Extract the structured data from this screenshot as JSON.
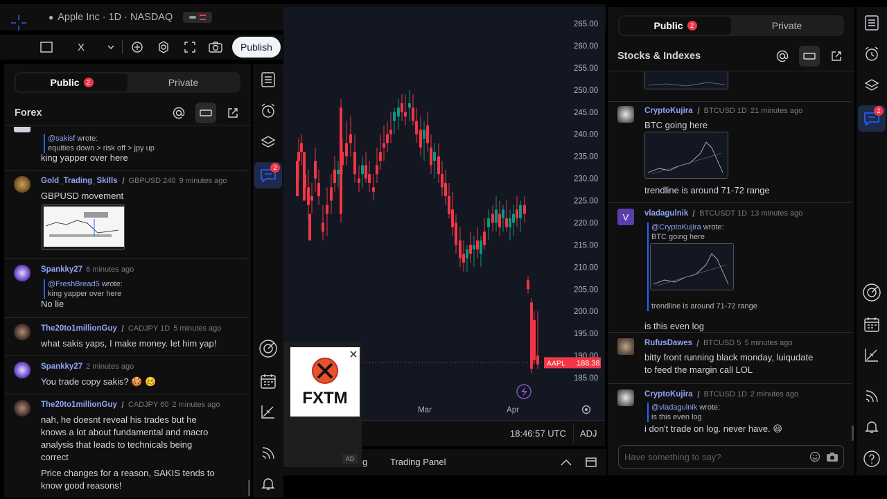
{
  "top": {
    "symbol_title": "Apple Inc · 1D · NASDAQ",
    "publish_label": "Publish",
    "toolbar_x_label": "X"
  },
  "left_chat": {
    "tab_public": "Public",
    "tab_private": "Private",
    "public_badge": "2",
    "room_title": "Forex",
    "messages": [
      {
        "quote_user": "@sakisf",
        "quote_wrote": "wrote:",
        "quote_text": "equities down > risk off > jpy up",
        "text": "king yapper over here"
      },
      {
        "user": "Gold_Trading_Skills",
        "symbol": "GBPUSD 240",
        "time": "9 minutes ago",
        "text": "GBPUSD movement"
      },
      {
        "user": "Spankky27",
        "time": "6 minutes ago",
        "quote_user": "@FreshBread5",
        "quote_wrote": "wrote:",
        "quote_text": "king yapper over here",
        "text": "No lie"
      },
      {
        "user": "The20to1millionGuy",
        "symbol": "CADJPY 1D",
        "time": "5 minutes ago",
        "text": "what sakis yaps, I make money. let him yap!"
      },
      {
        "user": "Spankky27",
        "time": "2 minutes ago",
        "text": "You trade copy sakis? 🍪 🥴"
      },
      {
        "user": "The20to1millionGuy",
        "symbol": "CADJPY 60",
        "time": "2 minutes ago",
        "text_lines": [
          "nah, he doesnt reveal his trades but he",
          "knows a lot about fundamental and macro",
          "analysis that leads to technicals being",
          "correct"
        ],
        "text2_lines": [
          "Price changes for a reason, SAKIS tends to",
          "know good reasons!"
        ]
      }
    ]
  },
  "mid_strip": {
    "chat_badge": "2"
  },
  "chart": {
    "price_labels": [
      "265.00",
      "260.00",
      "255.00",
      "250.00",
      "245.00",
      "240.00",
      "235.00",
      "230.00",
      "225.00",
      "220.00",
      "215.00",
      "210.00",
      "205.00",
      "200.00",
      "195.00",
      "190.00",
      "185.00"
    ],
    "time_labels": [
      "Mar",
      "Apr"
    ],
    "last_symbol": "AAPL",
    "last_price": "188.38",
    "clock": "18:46:57 UTC",
    "adj_label": "ADJ",
    "panel_tab_partial": "g",
    "panel_tab": "Trading Panel",
    "colors": {
      "up": "#089981",
      "down": "#f23645",
      "bg": "#131722"
    }
  },
  "ad": {
    "brand": "FXTM",
    "ad_label": "AD"
  },
  "right_chat": {
    "tab_public": "Public",
    "tab_private": "Private",
    "public_badge": "2",
    "room_title": "Stocks & Indexes",
    "messages": [
      {
        "user": "CryptoKujira",
        "symbol": "BTCUSD 1D",
        "time": "21 minutes ago",
        "text": "BTC going here",
        "text2": "trendline is around 71-72 range"
      },
      {
        "user": "vladagulnik",
        "avatar_letter": "V",
        "symbol": "BTCUSDT 1D",
        "time": "13 minutes ago",
        "quote_user": "@CryptoKujira",
        "quote_wrote": "wrote:",
        "quote_text": "BTC going here",
        "quote_text2": "trendline is around 71-72 range",
        "text": "is this even log"
      },
      {
        "user": "RufusDawes",
        "symbol": "BTCUSD 5",
        "time": "5 minutes ago",
        "text_lines": [
          "bitty front running black monday, luiqudate",
          "to feed the margin call LOL"
        ]
      },
      {
        "user": "CryptoKujira",
        "symbol": "BTCUSD 1D",
        "time": "2 minutes ago",
        "quote_user": "@vladagulnik",
        "quote_wrote": "wrote:",
        "quote_text": "is this even log",
        "text": "i don't trade on log. never have. 😃"
      }
    ],
    "composer_placeholder": "Have something to say?"
  },
  "right_strip": {
    "chat_badge": "2"
  }
}
